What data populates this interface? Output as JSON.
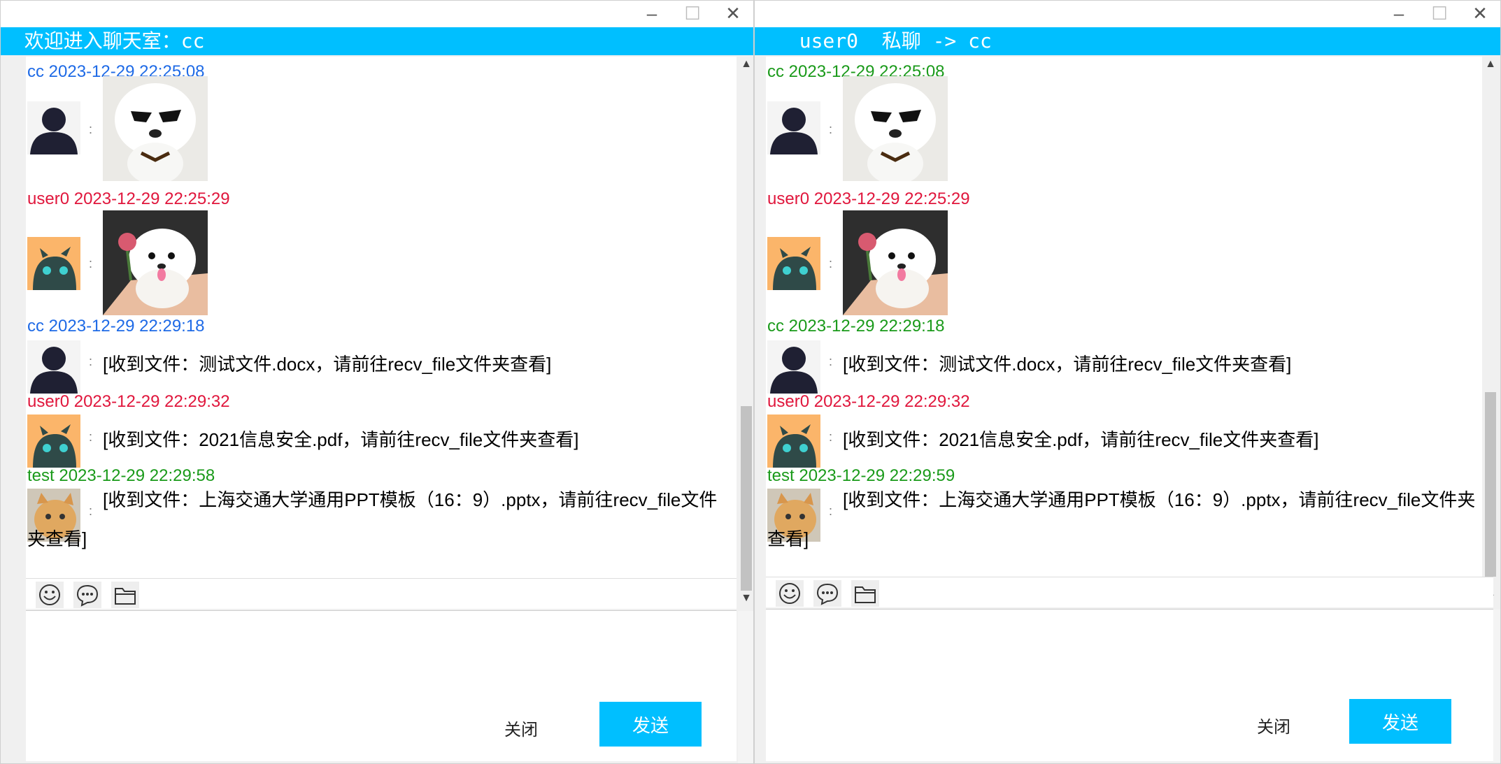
{
  "colors": {
    "accent": "#00bfff",
    "cc_left": "#1e6ae6",
    "user0": "#e0163c",
    "test": "#1a9a1a",
    "cc_right": "#1a9a1a"
  },
  "icons": [
    "minimize-icon",
    "maximize-icon",
    "close-icon",
    "smiley-icon",
    "chat-bubble-icon",
    "folder-icon"
  ],
  "window_controls": {
    "minimize": "–",
    "maximize": "☐",
    "close": "✕"
  },
  "left_window": {
    "banner_title": "  欢迎进入聊天室：cc",
    "messages": [
      {
        "sender": "cc",
        "time": "2023-12-29 22:25:08",
        "kind": "image",
        "colon": ":"
      },
      {
        "sender": "user0",
        "time": "2023-12-29 22:25:29",
        "kind": "image",
        "colon": ":"
      },
      {
        "sender": "cc",
        "time": "2023-12-29 22:29:18",
        "kind": "file",
        "colon": ":",
        "text": "[收到文件：测试文件.docx，请前往recv_file文件夹查看]"
      },
      {
        "sender": "user0",
        "time": "2023-12-29 22:29:32",
        "kind": "file",
        "colon": ":",
        "text": "[收到文件：2021信息安全.pdf，请前往recv_file文件夹查看]"
      },
      {
        "sender": "test",
        "time": "2023-12-29 22:29:58",
        "kind": "file",
        "colon": ":",
        "text": "[收到文件：上海交通大学通用PPT模板（16：9）.pptx，请前往recv_file文件夹查看]"
      }
    ],
    "close_label": "关闭",
    "send_label": "发送"
  },
  "right_window": {
    "banner_title": "  user0  私聊 -> cc",
    "messages": [
      {
        "sender": "cc",
        "time": "2023-12-29 22:25:08",
        "kind": "image",
        "colon": ":"
      },
      {
        "sender": "user0",
        "time": "2023-12-29 22:25:29",
        "kind": "image",
        "colon": ":"
      },
      {
        "sender": "cc",
        "time": "2023-12-29 22:29:18",
        "kind": "file",
        "colon": ":",
        "text": "[收到文件：测试文件.docx，请前往recv_file文件夹查看]"
      },
      {
        "sender": "user0",
        "time": "2023-12-29 22:29:32",
        "kind": "file",
        "colon": ":",
        "text": "[收到文件：2021信息安全.pdf，请前往recv_file文件夹查看]"
      },
      {
        "sender": "test",
        "time": "2023-12-29 22:29:59",
        "kind": "file",
        "colon": ":",
        "text": "[收到文件：上海交通大学通用PPT模板（16：9）.pptx，请前往recv_file文件夹查看]"
      }
    ],
    "close_label": "关闭",
    "send_label": "发送"
  }
}
